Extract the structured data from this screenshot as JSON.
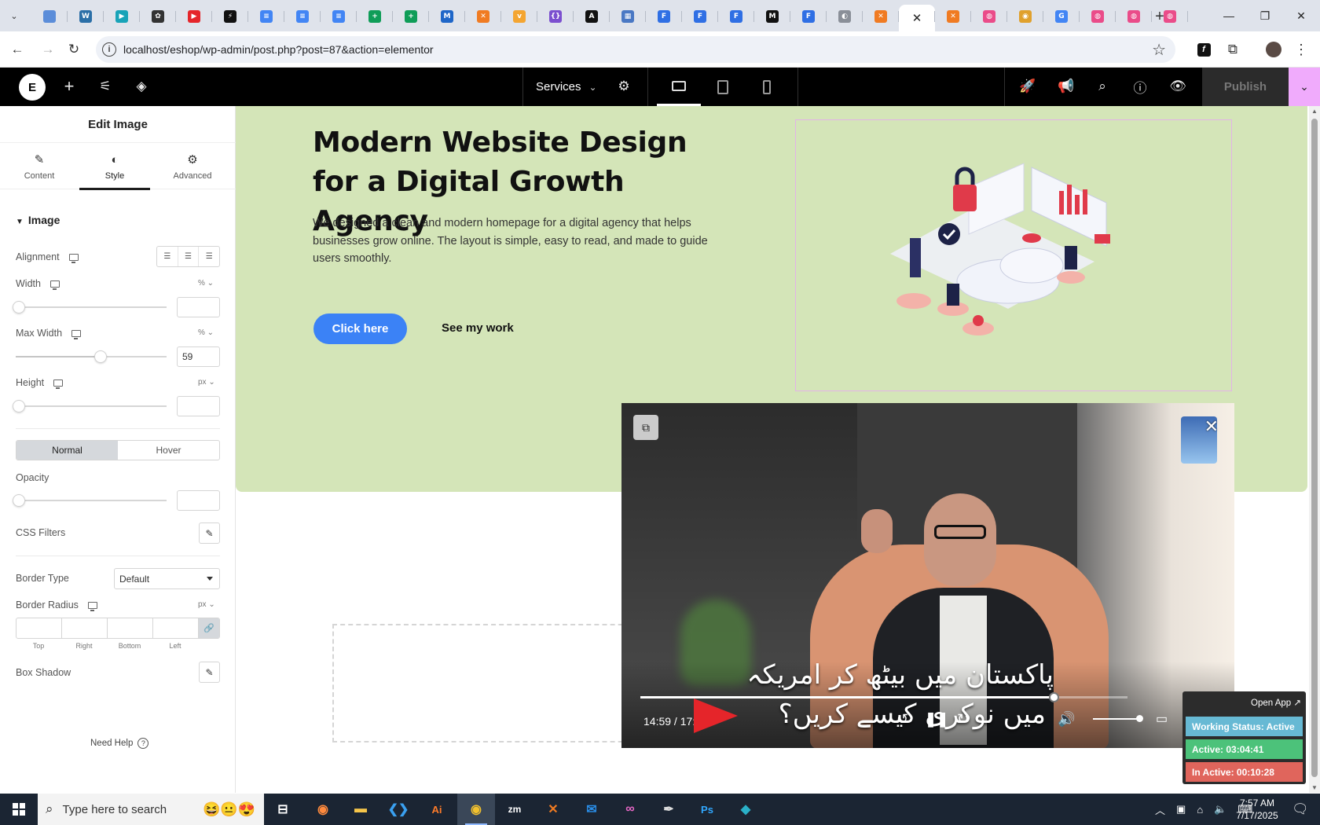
{
  "browser": {
    "active_tab_close": "✕",
    "new_tab": "+",
    "url": "localhost/eshop/wp-admin/post.php?post=87&action=elementor",
    "tab_favicons": [
      {
        "name": "tab-favicon-blue",
        "color": "#5b8dd9",
        "glyph": ""
      },
      {
        "name": "tab-favicon-wordpress",
        "color": "#2b6fa7",
        "glyph": "W"
      },
      {
        "name": "tab-favicon-teal",
        "color": "#18a3b8",
        "glyph": "▶"
      },
      {
        "name": "tab-favicon-openai",
        "color": "#333333",
        "glyph": "✿"
      },
      {
        "name": "tab-favicon-youtube",
        "color": "#e5252a",
        "glyph": "▶"
      },
      {
        "name": "tab-favicon-bolt",
        "color": "#111111",
        "glyph": "⚡"
      },
      {
        "name": "tab-favicon-docs",
        "color": "#4285f4",
        "glyph": "≡"
      },
      {
        "name": "tab-favicon-docs",
        "color": "#4285f4",
        "glyph": "≡"
      },
      {
        "name": "tab-favicon-docs",
        "color": "#4285f4",
        "glyph": "≡"
      },
      {
        "name": "tab-favicon-sheets",
        "color": "#0f9d58",
        "glyph": "+"
      },
      {
        "name": "tab-favicon-sheets",
        "color": "#0f9d58",
        "glyph": "+"
      },
      {
        "name": "tab-favicon-ms",
        "color": "#1e66c8",
        "glyph": "M"
      },
      {
        "name": "tab-favicon-xampp",
        "color": "#f07b22",
        "glyph": "✕"
      },
      {
        "name": "tab-favicon-v",
        "color": "#f4a531",
        "glyph": "v"
      },
      {
        "name": "tab-favicon-code",
        "color": "#7b4fcf",
        "glyph": "{}"
      },
      {
        "name": "tab-favicon-a",
        "color": "#111111",
        "glyph": "A"
      },
      {
        "name": "tab-favicon-grid",
        "color": "#4a78c4",
        "glyph": "▦"
      },
      {
        "name": "tab-favicon-f",
        "color": "#2f6fe4",
        "glyph": "F"
      },
      {
        "name": "tab-favicon-f",
        "color": "#2f6fe4",
        "glyph": "F"
      },
      {
        "name": "tab-favicon-f",
        "color": "#2f6fe4",
        "glyph": "F"
      },
      {
        "name": "tab-favicon-medium",
        "color": "#111111",
        "glyph": "M"
      },
      {
        "name": "tab-favicon-f",
        "color": "#2f6fe4",
        "glyph": "F"
      },
      {
        "name": "tab-favicon-globe",
        "color": "#8a8f98",
        "glyph": "◐"
      },
      {
        "name": "tab-favicon-xampp",
        "color": "#f07b22",
        "glyph": "✕"
      }
    ],
    "tab_favicons_after": [
      {
        "name": "tab-favicon-xampp",
        "color": "#f07b22",
        "glyph": "✕"
      },
      {
        "name": "tab-favicon-dribbble",
        "color": "#ea4c89",
        "glyph": "◍"
      },
      {
        "name": "tab-favicon-chrome",
        "color": "#e0a12d",
        "glyph": "◉"
      },
      {
        "name": "tab-favicon-google",
        "color": "#4285f4",
        "glyph": "G"
      },
      {
        "name": "tab-favicon-dribbble",
        "color": "#ea4c89",
        "glyph": "◍"
      },
      {
        "name": "tab-favicon-dribbble",
        "color": "#ea4c89",
        "glyph": "◍"
      },
      {
        "name": "tab-favicon-dribbble",
        "color": "#ea4c89",
        "glyph": "◍"
      }
    ]
  },
  "elementor": {
    "logo": "E",
    "page_name": "Services",
    "publish_label": "Publish"
  },
  "panel": {
    "title": "Edit Image",
    "tabs": [
      "Content",
      "Style",
      "Advanced"
    ],
    "section": "Image",
    "alignment_label": "Alignment",
    "width_label": "Width",
    "width_unit": "%",
    "width_value": "",
    "max_width_label": "Max Width",
    "max_width_unit": "%",
    "max_width_value": "59",
    "max_width_fraction": 0.59,
    "height_label": "Height",
    "height_unit": "px",
    "height_value": "",
    "state_normal": "Normal",
    "state_hover": "Hover",
    "opacity_label": "Opacity",
    "opacity_value": "",
    "css_filters_label": "CSS Filters",
    "border_type_label": "Border Type",
    "border_type_value": "Default",
    "border_radius_label": "Border Radius",
    "border_radius_unit": "px",
    "radius_labels": [
      "Top",
      "Right",
      "Bottom",
      "Left"
    ],
    "box_shadow_label": "Box Shadow",
    "need_help": "Need Help"
  },
  "canvas": {
    "hero_title": "Modern Website Design for a Digital Growth Agency",
    "hero_description": "We designed a clean and modern homepage for a digital agency that helps businesses grow online. The layout is simple, easy to read, and made to guide users smoothly.",
    "primary_button": "Click here",
    "secondary_link": "See my work",
    "hero_bg": "#d4e5b8",
    "accent": "#3b82f6"
  },
  "video": {
    "caption_line1": "پاکستان میں بیٹھ کر امریکہ",
    "caption_line2": "میں نوکری کیسے کریں؟",
    "time": "14:59 / 17:41",
    "progress_fraction": 0.848
  },
  "work_status": {
    "open_app": "Open App ↗",
    "status": "Working Status: Active",
    "active": "Active: 03:04:41",
    "inactive": "In Active: 00:10:28",
    "status_color": "#67b9d4",
    "active_color": "#4cc27a",
    "inactive_color": "#e0655c"
  },
  "taskbar": {
    "search_placeholder": "Type here to search",
    "time": "7:57 AM",
    "date": "7/17/2025"
  }
}
